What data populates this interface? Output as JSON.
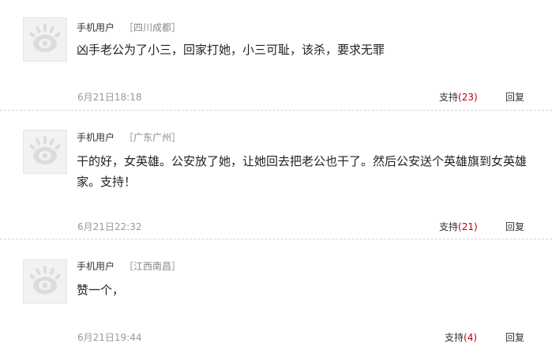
{
  "comments": [
    {
      "user": "手机用户",
      "location": "［四川成都］",
      "text": "凶手老公为了小三，回家打她，小三可耻，该杀，要求无罪",
      "time": "6月21日18:18",
      "support_label": "支持",
      "support_count": "(23)",
      "reply_label": "回复",
      "avatar_icon": "default-avatar-icon"
    },
    {
      "user": "手机用户",
      "location": "［广东广州］",
      "text": "干的好，女英雄。公安放了她，让她回去把老公也干了。然后公安送个英雄旗到女英雄家。支持！",
      "time": "6月21日22:32",
      "support_label": "支持",
      "support_count": "(21)",
      "reply_label": "回复",
      "avatar_icon": "default-avatar-icon"
    },
    {
      "user": "手机用户",
      "location": "［江西南昌］",
      "text": "赞一个，",
      "time": "6月21日19:44",
      "support_label": "支持",
      "support_count": "(4)",
      "reply_label": "回复",
      "avatar_icon": "default-avatar-icon"
    }
  ]
}
